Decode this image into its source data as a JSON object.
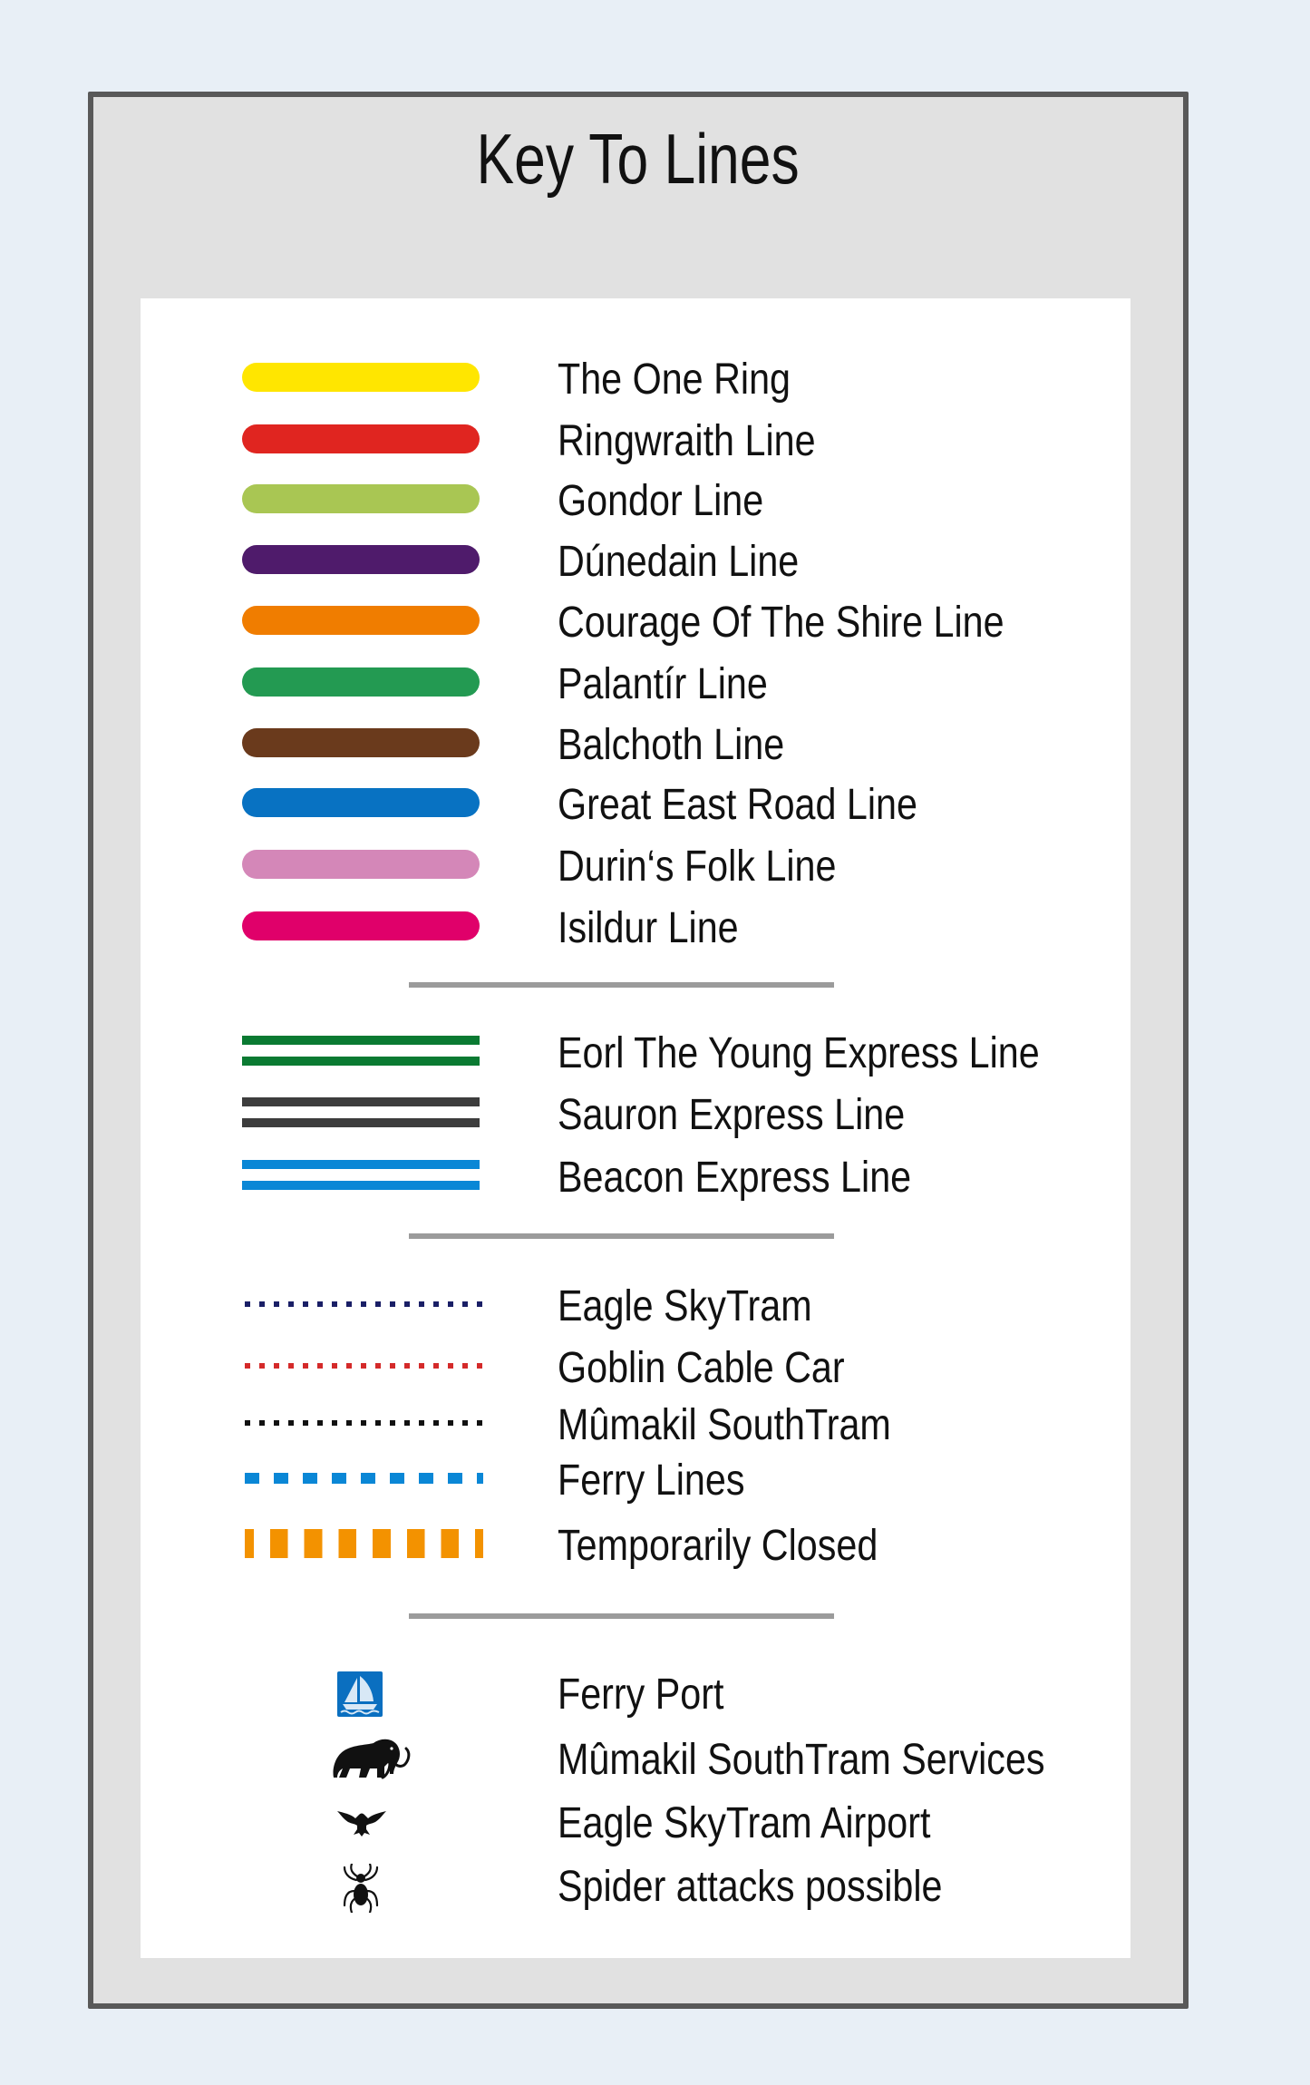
{
  "title": "Key To Lines",
  "sections": {
    "lines": [
      {
        "label": "The One Ring",
        "color": "#ffe600",
        "style": "solid"
      },
      {
        "label": "Ringwraith Line",
        "color": "#e02520",
        "style": "solid"
      },
      {
        "label": "Gondor Line",
        "color": "#a9c653",
        "style": "solid"
      },
      {
        "label": "Dúnedain Line",
        "color": "#4f1b6b",
        "style": "solid"
      },
      {
        "label": "Courage Of The Shire Line",
        "color": "#f07d00",
        "style": "solid"
      },
      {
        "label": "Palantír Line",
        "color": "#239a52",
        "style": "solid"
      },
      {
        "label": "Balchoth Line",
        "color": "#6a3a1c",
        "style": "solid"
      },
      {
        "label": "Great East Road Line",
        "color": "#0872c2",
        "style": "solid"
      },
      {
        "label": "Durin‘s Folk Line",
        "color": "#d487b8",
        "style": "solid"
      },
      {
        "label": "Isildur Line",
        "color": "#e0006a",
        "style": "solid"
      }
    ],
    "express_lines": [
      {
        "label": "Eorl The Young Express Line",
        "color": "#0a7a32",
        "style": "double"
      },
      {
        "label": "Sauron Express Line",
        "color": "#3d3d3d",
        "style": "double"
      },
      {
        "label": "Beacon Express Line",
        "color": "#0a87d6",
        "style": "double"
      }
    ],
    "special_lines": [
      {
        "label": "Eagle SkyTram",
        "color": "#1a1f66",
        "style": "dotted"
      },
      {
        "label": "Goblin Cable Car",
        "color": "#d42a2a",
        "style": "dotted"
      },
      {
        "label": "Mûmakil SouthTram",
        "color": "#111111",
        "style": "dotted"
      },
      {
        "label": "Ferry Lines",
        "color": "#0a87d6",
        "style": "dashed"
      },
      {
        "label": "Temporarily Closed",
        "color": "#f39200",
        "style": "bars"
      }
    ],
    "symbols": [
      {
        "label": "Ferry Port",
        "icon": "sailboat-icon",
        "color": "#0a6fc0"
      },
      {
        "label": "Mûmakil SouthTram Services",
        "icon": "mammoth-icon",
        "color": "#111111"
      },
      {
        "label": "Eagle SkyTram Airport",
        "icon": "eagle-icon",
        "color": "#111111"
      },
      {
        "label": "Spider attacks possible",
        "icon": "spider-icon",
        "color": "#111111"
      }
    ]
  }
}
